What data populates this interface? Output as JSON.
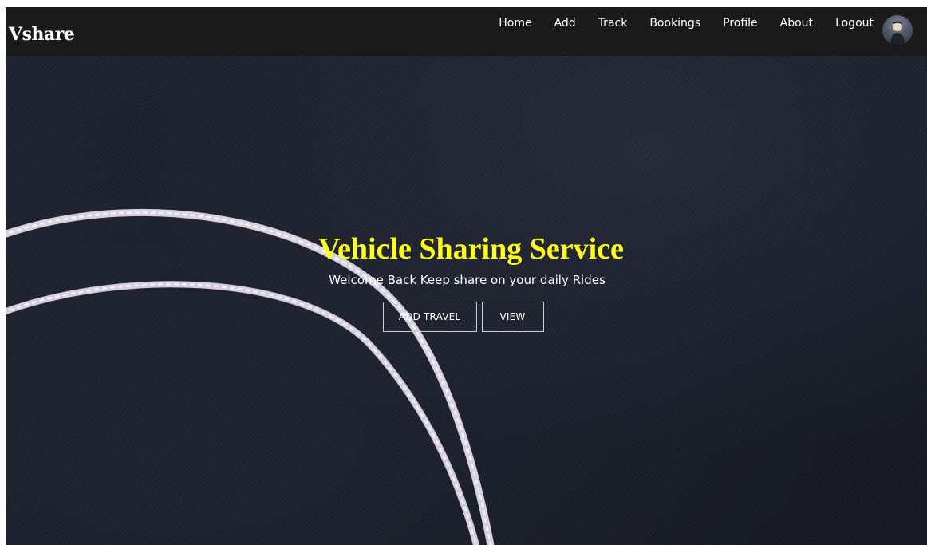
{
  "navbar": {
    "brand": "Vshare",
    "links": [
      "Home",
      "Add",
      "Track",
      "Bookings",
      "Profile",
      "About",
      "Logout"
    ]
  },
  "hero": {
    "title": "Vehicle Sharing Service",
    "subtitle": "Welcome Back Keep share on your daily Rides",
    "buttons": {
      "add_travel": "ADD TRAVEL",
      "view": "VIEW"
    }
  },
  "colors": {
    "navbar_bg": "#1a1a1a",
    "title": "#ffff1a",
    "hero_bg": "#1c202c"
  },
  "icons": {
    "avatar": "user-avatar-icon"
  }
}
